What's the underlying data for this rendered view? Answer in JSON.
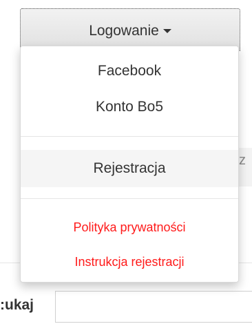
{
  "toggle": {
    "label": "Logowanie",
    "icon": "caret-down-icon"
  },
  "menu": {
    "items": [
      {
        "label": "Facebook"
      },
      {
        "label": "Konto Bo5"
      },
      {
        "label": "Rejestracja"
      },
      {
        "label": "Polityka prywatności"
      },
      {
        "label": "Instrukcja rejestracji"
      }
    ],
    "link_color": "#ff1a1a"
  },
  "background": {
    "partial_letter": "z",
    "search_label": "ukaj:"
  }
}
